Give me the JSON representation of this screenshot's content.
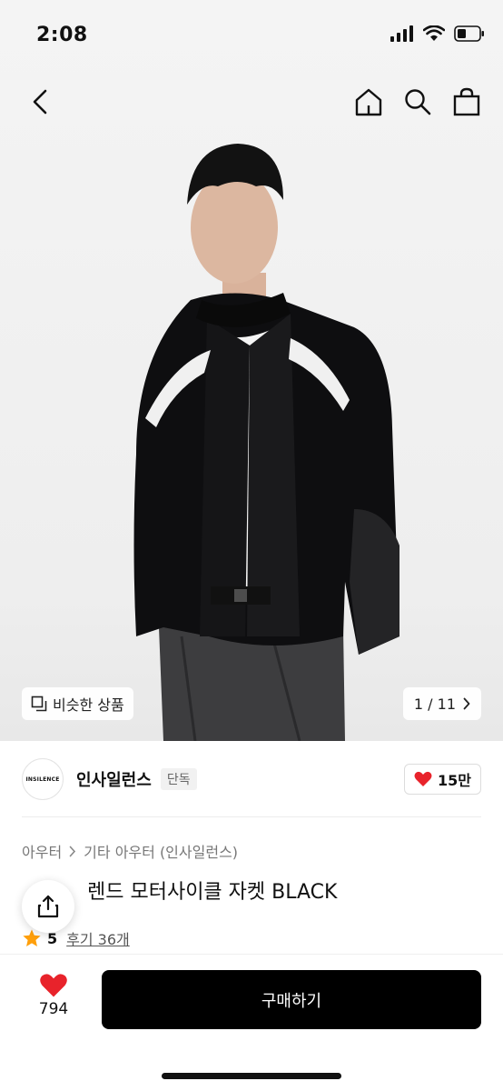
{
  "status_bar": {
    "time": "2:08"
  },
  "hero": {
    "similar_label": "비슷한 상품",
    "page_current": "1",
    "page_separator": "/",
    "page_total": "11"
  },
  "brand": {
    "logo_text": "INSILENCE",
    "name": "인사일런스",
    "tag": "단독",
    "likes": "15만"
  },
  "product": {
    "breadcrumb": [
      "아우터",
      "기타 아우터 (인사일런스)"
    ],
    "title_visible": "렌드 모터사이클 자켓 BLACK",
    "rating": "5",
    "review_label": "후기 36개"
  },
  "bottom_bar": {
    "wish_count": "794",
    "buy_label": "구매하기"
  },
  "icons": {
    "back": "chevron-left-icon",
    "home": "home-icon",
    "search": "search-icon",
    "bag": "shopping-bag-icon",
    "share": "share-icon",
    "heart": "heart-icon",
    "star": "star-icon"
  },
  "colors": {
    "heart_red": "#e8232b",
    "star_orange": "#ff9f0a",
    "buy_button": "#000000"
  }
}
